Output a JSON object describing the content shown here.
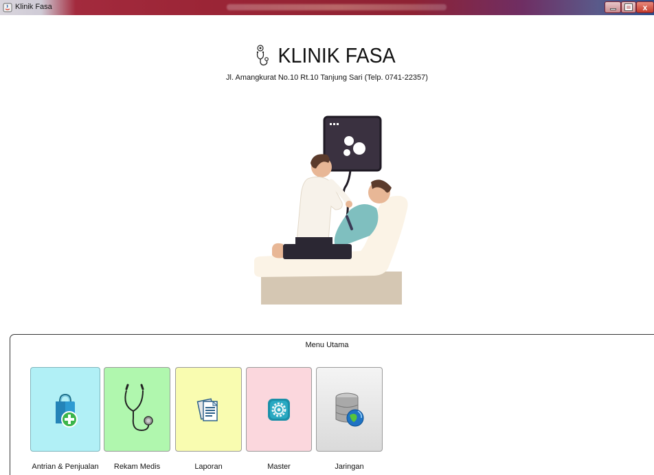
{
  "window": {
    "title": "Klinik Fasa"
  },
  "header": {
    "clinic_name": "KLINIK FASA",
    "address": "Jl. Amangkurat No.10 Rt.10 Tanjung Sari (Telp. 0741-22357)",
    "logo_icon": "stethoscope-icon"
  },
  "menu": {
    "title": "Menu Utama",
    "items": [
      {
        "label": "Antrian & Penjualan",
        "icon": "shopping-bag-plus-icon",
        "color": "#b1f0f6"
      },
      {
        "label": "Rekam Medis",
        "icon": "stethoscope-icon",
        "color": "#b0f7ae"
      },
      {
        "label": "Laporan",
        "icon": "documents-icon",
        "color": "#f9fcb0"
      },
      {
        "label": "Master",
        "icon": "gear-icon",
        "color": "#fbd7dd"
      },
      {
        "label": "Jaringan",
        "icon": "database-globe-icon",
        "color": "#e6e6e6"
      }
    ]
  },
  "illustration": {
    "icon": "doctor-patient-illustration"
  },
  "colors": {
    "titlebar": "#9b2536",
    "close_button": "#c43a2a"
  }
}
